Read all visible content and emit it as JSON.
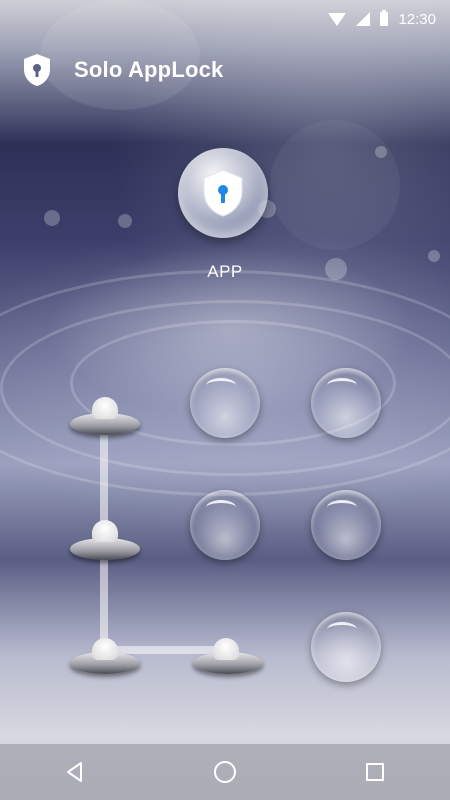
{
  "status_bar": {
    "time": "12:30",
    "icons": [
      "wifi-icon",
      "signal-icon",
      "battery-icon"
    ]
  },
  "app_bar": {
    "title": "Solo AppLock",
    "logo_icon": "shield-lock-icon"
  },
  "lock_screen": {
    "app_icon": "shield-keyhole-icon",
    "app_label": "APP",
    "pattern": {
      "grid": "3x3",
      "selected_nodes": [
        "top-left",
        "middle-left",
        "bottom-left",
        "bottom-middle"
      ],
      "unselected_nodes": [
        "top-middle",
        "top-right",
        "middle-middle",
        "middle-right",
        "bottom-right"
      ]
    },
    "accent_color": "#1e88e5"
  },
  "nav_bar": {
    "buttons": [
      "back-icon",
      "home-icon",
      "recents-icon"
    ]
  }
}
